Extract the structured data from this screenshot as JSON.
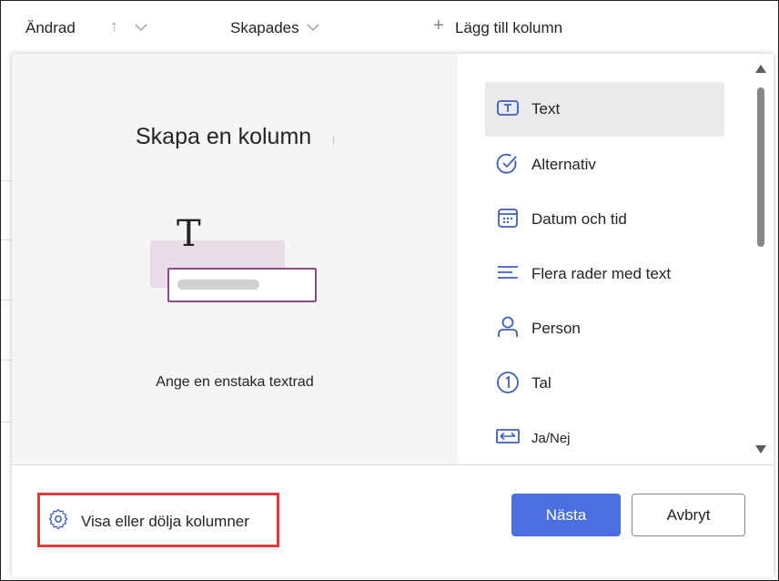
{
  "header": {
    "col_modified": "Ändrad",
    "col_created": "Skapades",
    "add_column": "Lägg till kolumn"
  },
  "panel": {
    "title": "Skapa en kolumn",
    "description": "Ange en enstaka textrad",
    "options": [
      {
        "label": "Text",
        "icon": "text-icon",
        "selected": true
      },
      {
        "label": "Alternativ",
        "icon": "choice-check-icon"
      },
      {
        "label": "Datum och tid",
        "icon": "calendar-icon"
      },
      {
        "label": "Flera rader med text",
        "icon": "multiline-text-icon"
      },
      {
        "label": "Person",
        "icon": "person-icon"
      },
      {
        "label": "Tal",
        "icon": "number-icon"
      },
      {
        "label": "Ja/Nej",
        "icon": "yes-no-icon"
      }
    ]
  },
  "footer": {
    "show_hide": "Visa eller dölja kolumner",
    "next": "Nästa",
    "cancel": "Avbryt"
  },
  "colors": {
    "accent": "#4a6fde",
    "highlight_border": "#e03a3a",
    "illustration": "#8a4d84"
  }
}
